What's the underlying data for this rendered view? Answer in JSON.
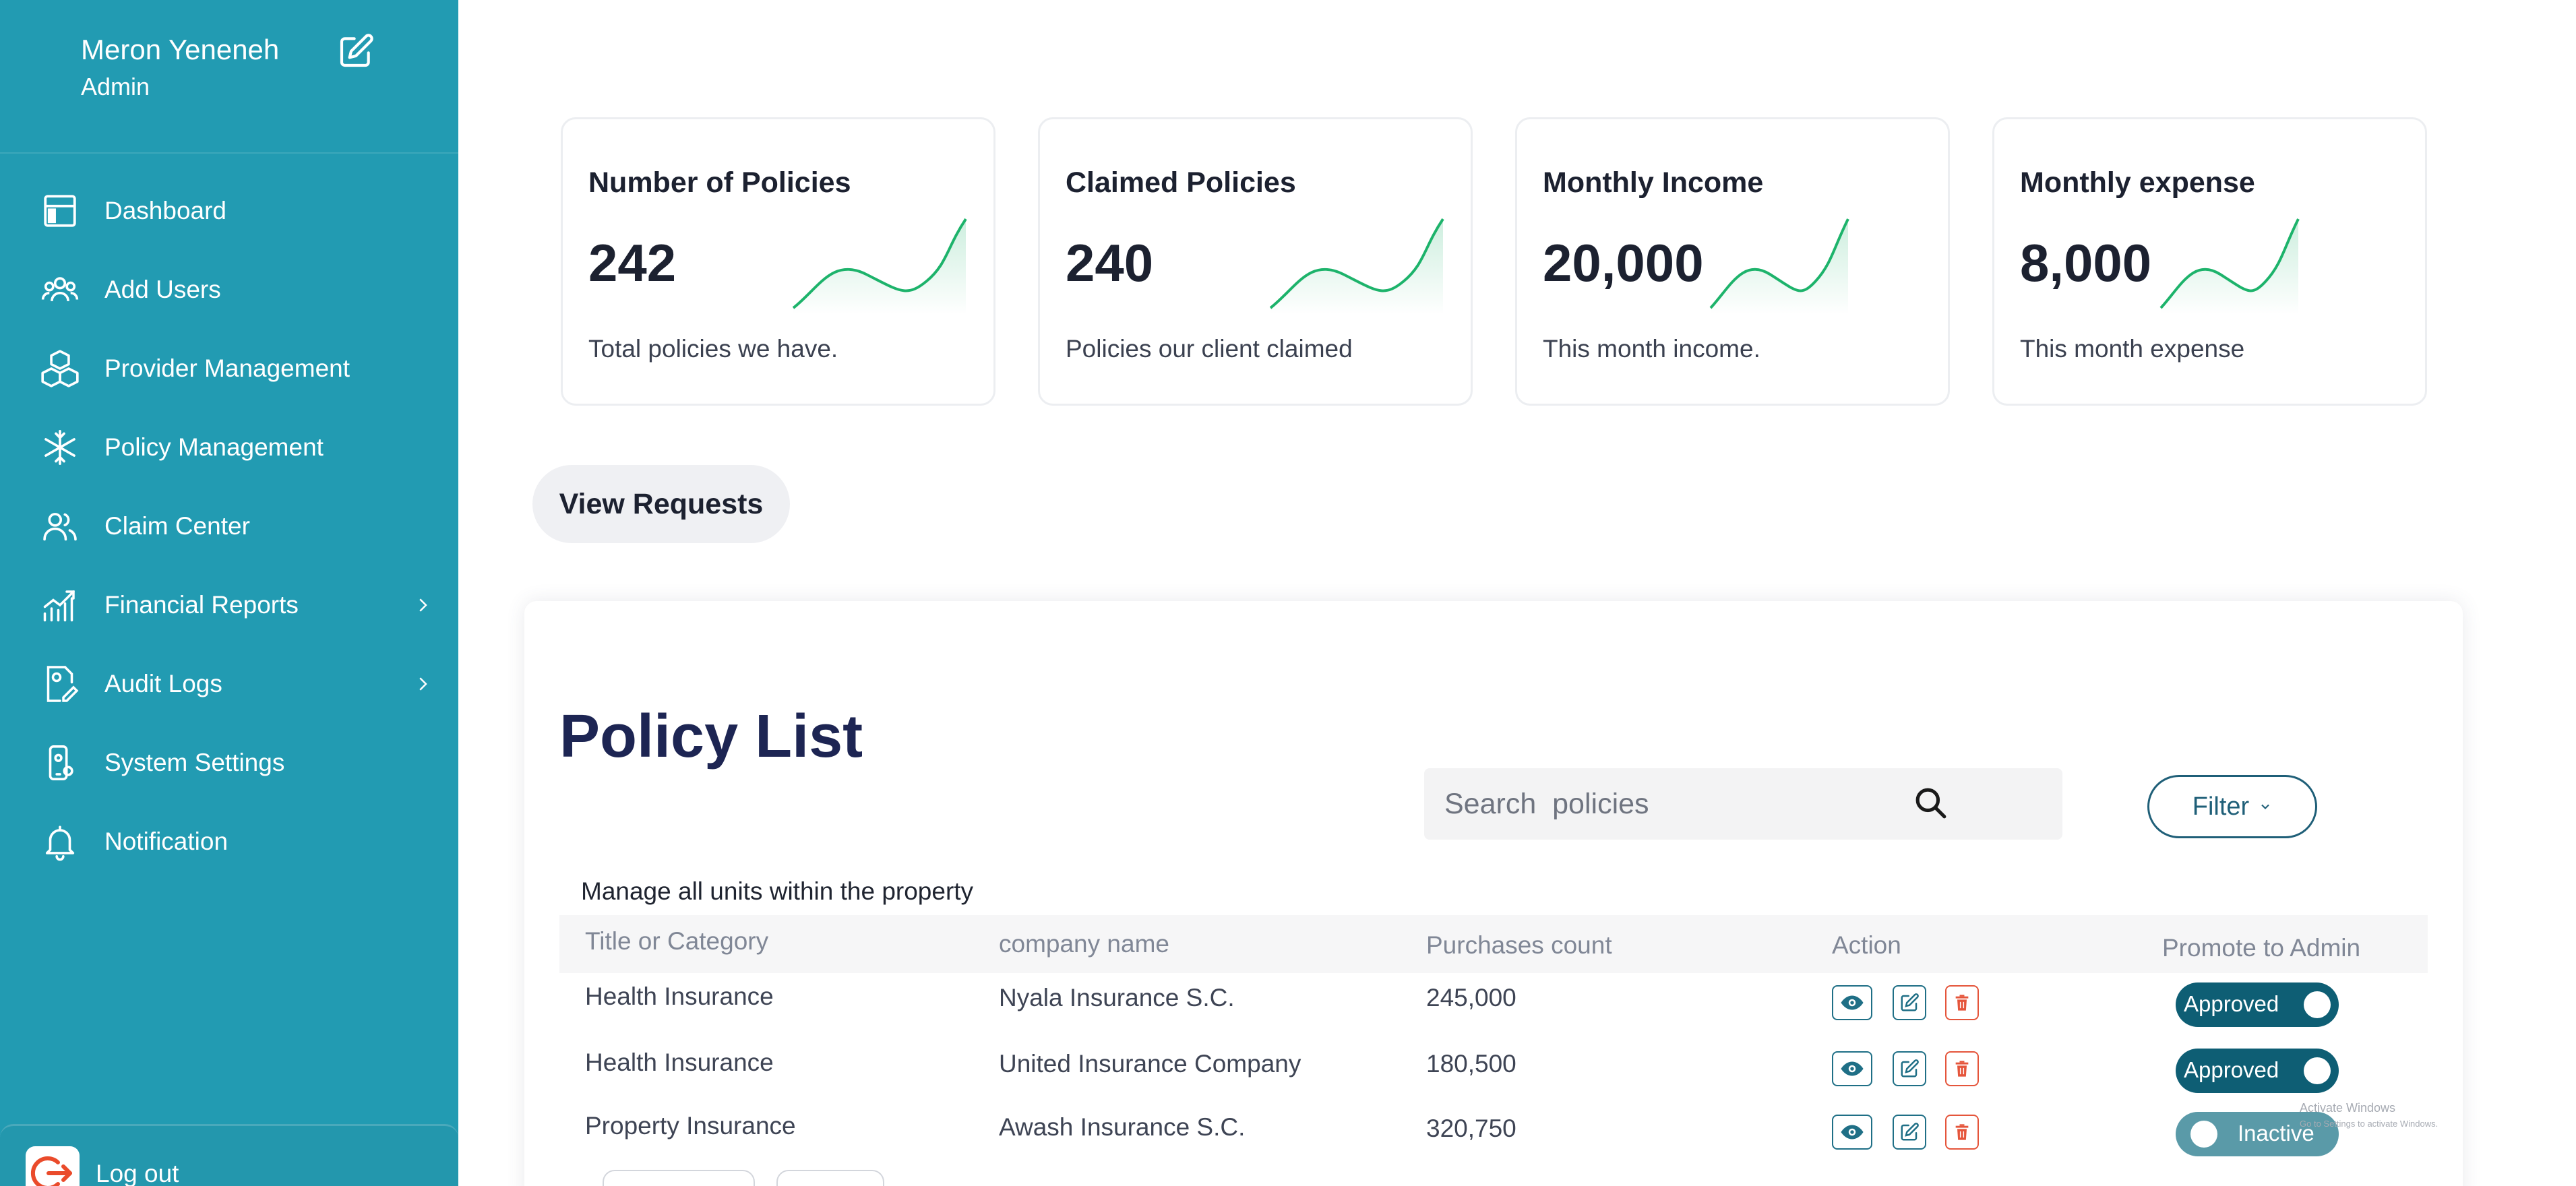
{
  "profile": {
    "name": "Meron Yeneneh",
    "role": "Admin",
    "edit_icon": "edit-icon"
  },
  "nav": {
    "items": [
      {
        "label": "Dashboard",
        "icon": "dashboard-icon"
      },
      {
        "label": "Add Users",
        "icon": "users-icon"
      },
      {
        "label": "Provider Management",
        "icon": "boxes-icon"
      },
      {
        "label": "Policy Management",
        "icon": "snowflake-icon"
      },
      {
        "label": "Claim Center",
        "icon": "people-icon"
      },
      {
        "label": "Financial Reports",
        "icon": "chart-icon"
      },
      {
        "label": "Audit Logs",
        "icon": "document-gear-icon"
      },
      {
        "label": "System Settings",
        "icon": "phone-settings-icon"
      },
      {
        "label": "Notification",
        "icon": "bell-icon"
      }
    ],
    "logout_label": "Log out"
  },
  "cards": [
    {
      "title": "Number of Policies",
      "value": "242",
      "subtitle": "Total policies we have."
    },
    {
      "title": "Claimed Policies",
      "value": "240",
      "subtitle": "Policies our client claimed"
    },
    {
      "title": "Monthly Income",
      "value": "20,000",
      "subtitle": "This month income."
    },
    {
      "title": "Monthly expense",
      "value": "8,000",
      "subtitle": "This month expense"
    }
  ],
  "view_requests_label": "View Requests",
  "policy_list": {
    "title": "Policy List",
    "subtitle": "Manage all units within the property",
    "search_placeholder": "Search  policies",
    "filter_label": "Filter",
    "columns": [
      "Title or Category",
      "company name",
      "Purchases count",
      "Action",
      "Promote to Admin"
    ],
    "rows": [
      {
        "category": "Health Insurance",
        "company": "Nyala Insurance S.C.",
        "count": "245,000",
        "status": "Approved",
        "active": true
      },
      {
        "category": "Health Insurance",
        "company": "United Insurance Company",
        "count": "180,500",
        "status": "Approved",
        "active": true
      },
      {
        "category": "Property Insurance",
        "company": "Awash Insurance S.C.",
        "count": "320,750",
        "status": "Inactive",
        "active": false
      }
    ]
  },
  "watermark": {
    "line1": "Activate Windows",
    "line2": "Go to Settings to activate Windows."
  },
  "colors": {
    "sidebar": "#229bb2",
    "accent": "#0e5e74",
    "spark": "#1db36b",
    "delete": "#e5553b"
  }
}
